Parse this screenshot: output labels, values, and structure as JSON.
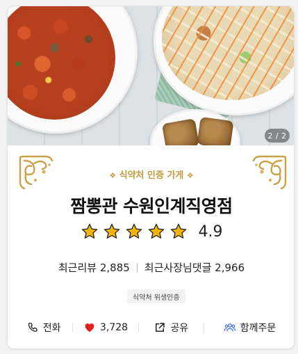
{
  "photo": {
    "counter": "2 / 2"
  },
  "store": {
    "certification_label": "식약처 인증 가게",
    "diamond_left": "❖",
    "diamond_right": "❖",
    "name": "짬뽕관 수원인계직영점",
    "rating": "4.9",
    "star_count": 5,
    "star_color": "#f2b705",
    "review_label": "최근리뷰 2,885",
    "owner_reply_label": "최근사장님댓글 2,966",
    "badge": "식약처 위생인증"
  },
  "actions": {
    "call": "전화",
    "likes": "3,728",
    "share": "공유",
    "group_order": "함께주문"
  },
  "colors": {
    "gold": "#c19a3d",
    "heart": "#e0201f",
    "group_icon": "#3d6fe0"
  }
}
